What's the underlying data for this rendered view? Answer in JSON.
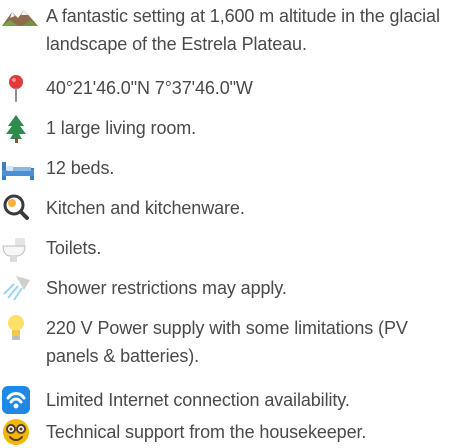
{
  "items": [
    {
      "icon": "mountain-icon",
      "text": "A fantastic setting at 1,600 m altitude in the glacial landscape of the Estrela Plateau."
    },
    {
      "icon": "pin-icon",
      "text": "40°21'46.0\"N 7°37'46.0\"W"
    },
    {
      "icon": "tree-icon",
      "text": "1 large living room."
    },
    {
      "icon": "bed-icon",
      "text": "12 beds."
    },
    {
      "icon": "magnifier-icon",
      "text": "Kitchen and kitchenware."
    },
    {
      "icon": "toilet-icon",
      "text": "Toilets."
    },
    {
      "icon": "shower-icon",
      "text": "Shower restrictions may apply."
    },
    {
      "icon": "lightbulb-icon",
      "text": "220 V Power supply with some limitations (PV panels & batteries)."
    },
    {
      "icon": "wifi-icon",
      "text": "Limited Internet connection availability."
    },
    {
      "icon": "nerd-face-icon",
      "text": "Technical support from the housekeeper."
    }
  ]
}
